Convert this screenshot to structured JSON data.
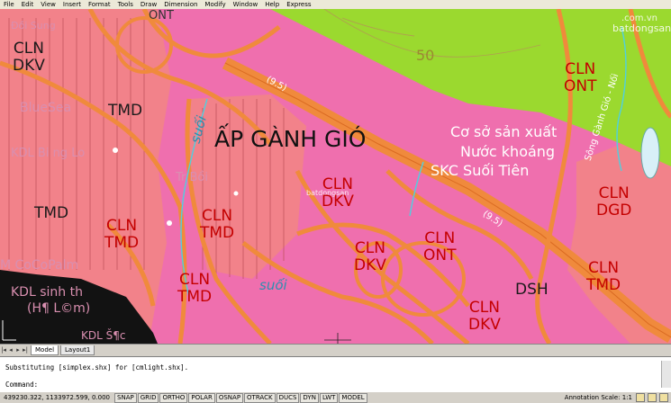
{
  "menu": [
    "File",
    "Edit",
    "View",
    "Insert",
    "Format",
    "Tools",
    "Draw",
    "Dimension",
    "Modify",
    "Window",
    "Help",
    "Express"
  ],
  "map": {
    "place_name": "ẤP GÀNH GIÓ",
    "contour": "50",
    "factory_lines": [
      "Cơ sở sản xuất",
      "Nước khoáng",
      "SKC  Suối Tiên"
    ],
    "parcels": [
      {
        "l1": "CLN",
        "l2": "DKV"
      },
      {
        "l1": "TMD",
        "l2": ""
      },
      {
        "l1": "TMD",
        "l2": ""
      },
      {
        "l1": "CLN",
        "l2": "TMD"
      },
      {
        "l1": "CLN",
        "l2": "TMD"
      },
      {
        "l1": "CLN",
        "l2": "DKV"
      },
      {
        "l1": "CLN",
        "l2": "DKV"
      },
      {
        "l1": "CLN",
        "l2": "ONT"
      },
      {
        "l1": "CLN",
        "l2": "TMD"
      },
      {
        "l1": "CLN",
        "l2": "DKV"
      },
      {
        "l1": "DSH",
        "l2": ""
      },
      {
        "l1": "CLN",
        "l2": "ONT"
      },
      {
        "l1": "CLN",
        "l2": "DGD"
      },
      {
        "l1": "CLN",
        "l2": "TMD"
      }
    ],
    "ghost_text": [
      "BlueSea",
      "KDL  Bi  ng Lo",
      "M  CoCoPalm",
      "KDL  sinh  th",
      "(H¶  L©m)",
      "KDL  Š¶c",
      "Đồi  Sung",
      "Tr Bồi"
    ],
    "road_label_1": "(9.5)",
    "road_label_2": "(9.5)",
    "stream_label": "Sông Gành Gió - Nối",
    "watermark": "batdongsan",
    "watermark_sub": ".com.vn",
    "suoi_1": "suối",
    "suoi_2": "suối",
    "top_text": "ONT"
  },
  "tabs": {
    "model": "Model",
    "layout": "Layout1"
  },
  "command": {
    "history": "Substituting [simplex.shx] for [cmlight.shx].",
    "prompt": "Command:"
  },
  "status": {
    "coords": "439230.322, 1133972.599, 0.000",
    "toggles": [
      "SNAP",
      "GRID",
      "ORTHO",
      "POLAR",
      "OSNAP",
      "OTRACK",
      "DUCS",
      "DYN",
      "LWT",
      "MODEL"
    ],
    "annotation_scale": "Annotation Scale: 1:1"
  },
  "colors": {
    "land_pink": "#ef6fae",
    "green": "#9bd92f",
    "roads": "#f08a3c",
    "water": "#1a1a1a",
    "salmon": "#f2828a"
  }
}
